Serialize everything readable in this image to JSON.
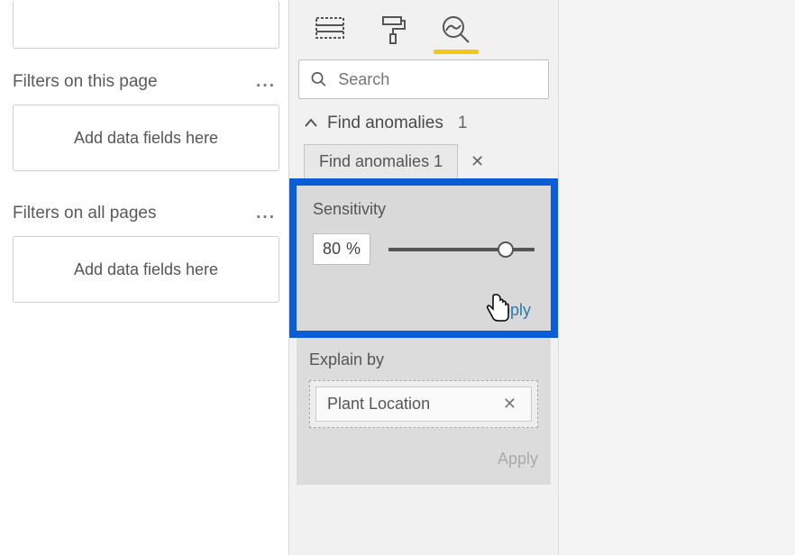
{
  "filters": {
    "page_header": "Filters on this page",
    "all_header": "Filters on all pages",
    "placeholder": "Add data fields here",
    "ellipsis": "..."
  },
  "search": {
    "placeholder": "Search"
  },
  "accordion": {
    "title": "Find anomalies",
    "count": "1"
  },
  "tab": {
    "label": "Find anomalies 1",
    "close": "✕"
  },
  "sensitivity": {
    "title": "Sensitivity",
    "value": "80",
    "unit": "%",
    "apply": "Apply"
  },
  "explain": {
    "title": "Explain by",
    "chip": "Plant Location",
    "chip_close": "✕",
    "apply": "Apply"
  },
  "highlight_color": "#0a5cd7"
}
